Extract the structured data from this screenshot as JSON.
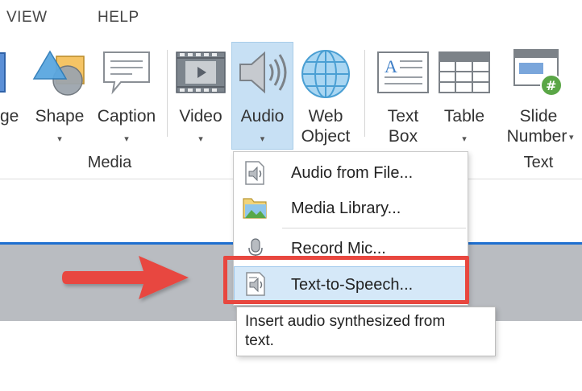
{
  "menubar": {
    "items": [
      {
        "label": "VIEW"
      },
      {
        "label": "HELP"
      }
    ]
  },
  "ribbon": {
    "buttons": [
      {
        "label": "ge",
        "icon": "image-icon"
      },
      {
        "label": "Shape",
        "icon": "shape-icon",
        "has_dropdown": true
      },
      {
        "label": "Caption",
        "icon": "caption-icon",
        "has_dropdown": true
      },
      {
        "label": "Video",
        "icon": "video-icon",
        "has_dropdown": true
      },
      {
        "label": "Audio",
        "icon": "speaker-icon",
        "has_dropdown": true,
        "active": true
      },
      {
        "label_line1": "Web",
        "label_line2": "Object",
        "icon": "globe-icon"
      },
      {
        "label_line1": "Text",
        "label_line2": "Box",
        "icon": "textbox-icon"
      },
      {
        "label": "Table",
        "icon": "table-icon",
        "has_dropdown": true
      },
      {
        "label_line1": "Slide",
        "label_line2": "Number",
        "icon": "slide-number-icon",
        "has_dropdown": true
      }
    ],
    "groups": {
      "media": "Media",
      "text": "Text"
    },
    "caret": "▾"
  },
  "audio_menu": {
    "items": [
      {
        "label": "Audio from File...",
        "icon": "audio-file-icon"
      },
      {
        "label": "Media Library...",
        "icon": "media-library-icon"
      },
      {
        "label": "Record Mic...",
        "icon": "microphone-icon"
      },
      {
        "label": "Text-to-Speech...",
        "icon": "text-to-speech-icon",
        "highlighted": true
      }
    ]
  },
  "tooltip": {
    "line1": "Insert audio synthesized from",
    "line2": "text."
  },
  "colors": {
    "accent_blue": "#1e6fd0",
    "highlight": "#c7e0f4",
    "annotation_red": "#e8473f"
  }
}
